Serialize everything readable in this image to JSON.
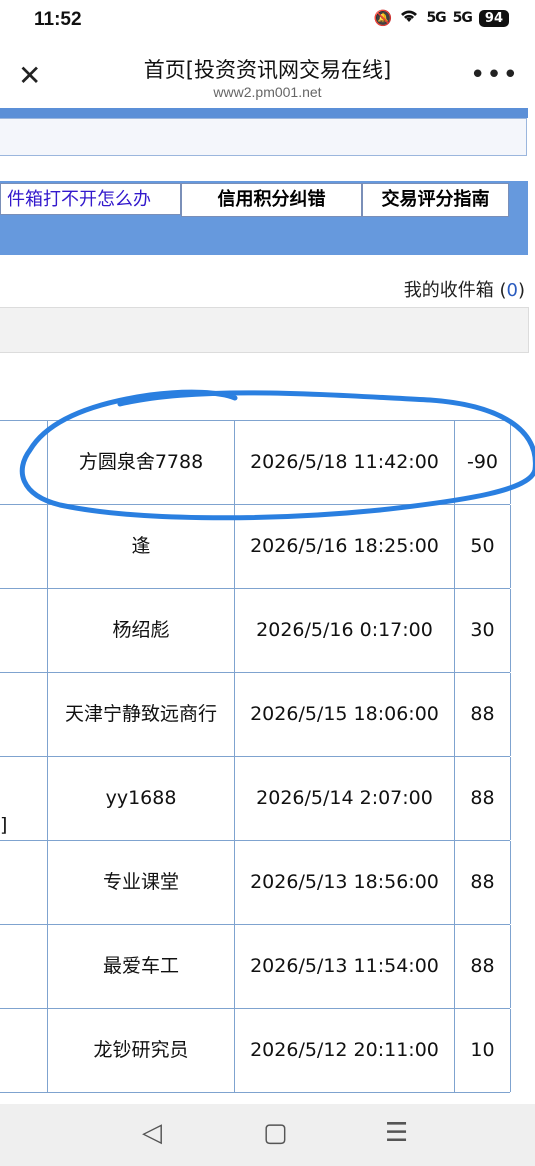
{
  "status": {
    "time": "11:52",
    "battery": "94",
    "signal1": "5G",
    "signal2": "5G"
  },
  "browser": {
    "title": "首页[投资资讯网交易在线]",
    "url": "www2.pm001.net"
  },
  "tabs": [
    "件箱打不开怎么办",
    "信用积分纠错",
    "交易评分指南"
  ],
  "inbox": {
    "label": "我的收件箱 (",
    "count": "0",
    "close": ")"
  },
  "table": {
    "rows": [
      {
        "marker": "",
        "name": "方圆泉舍7788",
        "time": "2026/5/18 11:42:00",
        "score": "-90"
      },
      {
        "marker": "",
        "name": "逢",
        "time": "2026/5/16 18:25:00",
        "score": "50"
      },
      {
        "marker": "",
        "name": "杨绍彪",
        "time": "2026/5/16 0:17:00",
        "score": "30"
      },
      {
        "marker": "",
        "name": "天津宁静致远商行",
        "time": "2026/5/15 18:06:00",
        "score": "88"
      },
      {
        "marker": "]",
        "name": "yy1688",
        "time": "2026/5/14 2:07:00",
        "score": "88"
      },
      {
        "marker": "",
        "name": "专业课堂",
        "time": "2026/5/13 18:56:00",
        "score": "88"
      },
      {
        "marker": "",
        "name": "最爱车工",
        "time": "2026/5/13 11:54:00",
        "score": "88"
      },
      {
        "marker": "",
        "name": "龙钞研究员",
        "time": "2026/5/12 20:11:00",
        "score": "10"
      }
    ]
  },
  "colors": {
    "accent_blue": "#6699dd",
    "link": "#3319cc",
    "annotation": "#2a7fe0"
  },
  "icons": [
    "close-icon",
    "more-icon",
    "mute-icon",
    "wifi-icon",
    "back-nav-icon",
    "home-nav-icon",
    "menu-nav-icon"
  ]
}
